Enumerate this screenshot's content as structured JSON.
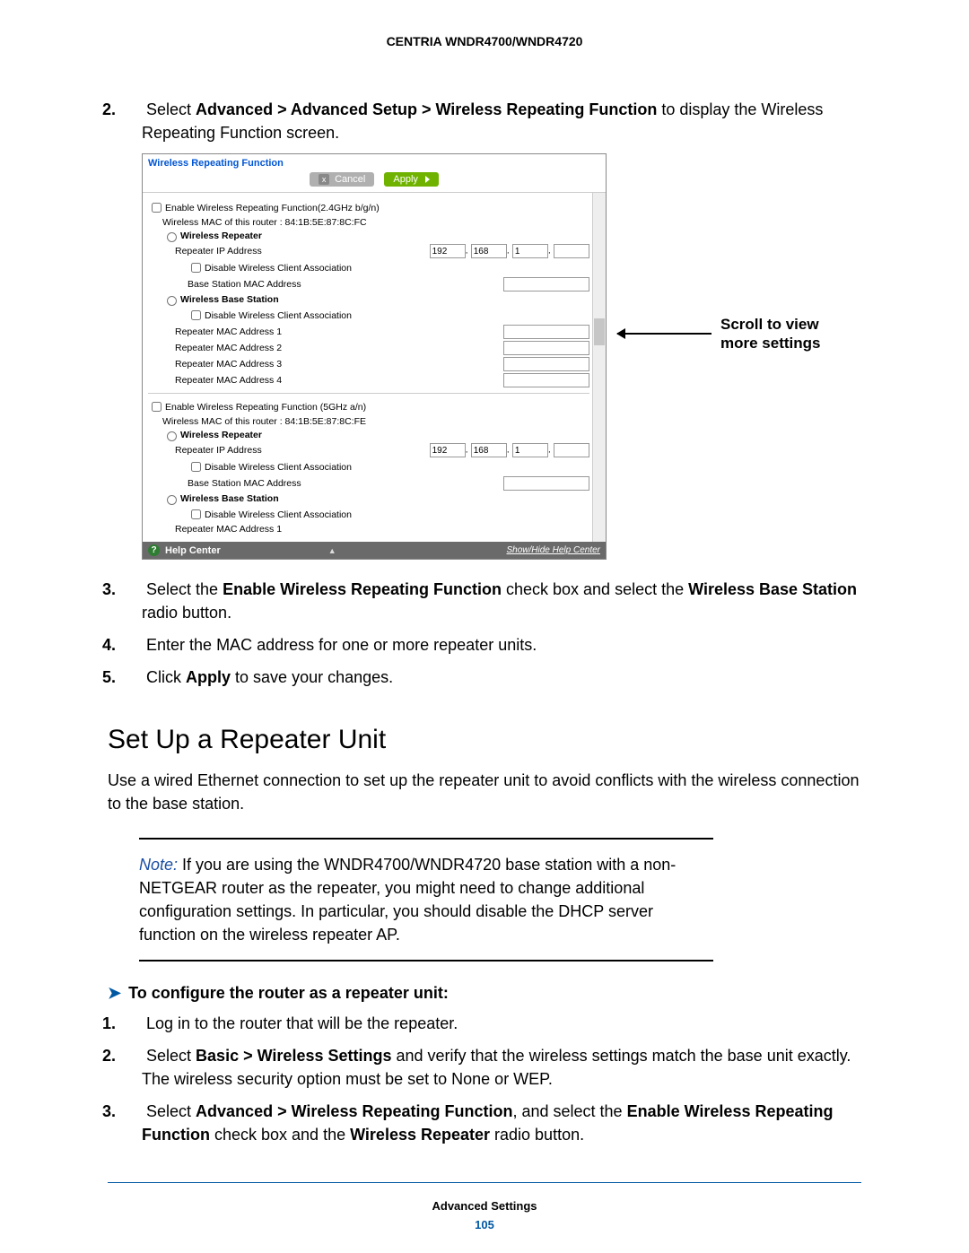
{
  "header": "CENTRIA WNDR4700/WNDR4720",
  "step2": {
    "num": "2.",
    "pre": "Select ",
    "path": "Advanced > Advanced Setup > Wireless Repeating Function",
    "post": " to display the Wireless Repeating Function screen."
  },
  "shot": {
    "title": "Wireless Repeating Function",
    "cancel": "Cancel",
    "apply": "Apply",
    "g24": {
      "enable": "Enable Wireless Repeating Function(2.4GHz b/g/n)",
      "mac": "Wireless MAC of this router : 84:1B:5E:87:8C:FC",
      "wr": "Wireless Repeater",
      "rip": "Repeater IP Address",
      "ip": [
        "192",
        "168",
        "1",
        ""
      ],
      "dwca": "Disable Wireless Client Association",
      "bsmac": "Base Station MAC Address",
      "wbs": "Wireless Base Station",
      "dwca2": "Disable Wireless Client Association",
      "r1": "Repeater MAC Address 1",
      "r2": "Repeater MAC Address 2",
      "r3": "Repeater MAC Address 3",
      "r4": "Repeater MAC Address 4"
    },
    "g5": {
      "enable": "Enable Wireless Repeating Function (5GHz a/n)",
      "mac": "Wireless MAC of this router : 84:1B:5E:87:8C:FE",
      "wr": "Wireless Repeater",
      "rip": "Repeater IP Address",
      "ip": [
        "192",
        "168",
        "1",
        ""
      ],
      "dwca": "Disable Wireless Client Association",
      "bsmac": "Base Station MAC Address",
      "wbs": "Wireless Base Station",
      "dwca2": "Disable Wireless Client Association",
      "r1": "Repeater MAC Address 1"
    },
    "help": "Help Center",
    "helplink": "Show/Hide Help Center"
  },
  "callout": {
    "l1": "Scroll to view",
    "l2": "more settings"
  },
  "step3": {
    "num": "3.",
    "pre": "Select the ",
    "b1": "Enable Wireless Repeating Function",
    "mid": " check box and select the ",
    "b2": "Wireless Base Station",
    "post": " radio button."
  },
  "step4": {
    "num": "4.",
    "text": "Enter the MAC address for one or more repeater units."
  },
  "step5": {
    "num": "5.",
    "pre": "Click ",
    "b": "Apply",
    "post": " to save your changes."
  },
  "h2": "Set Up a Repeater Unit",
  "para": "Use a wired Ethernet connection to set up the repeater unit to avoid conflicts with the wireless connection to the base station.",
  "note": {
    "label": "Note:  ",
    "text": "If you are using the WNDR4700/WNDR4720 base station with a non-NETGEAR router as the repeater, you might need to change additional configuration settings. In particular, you should disable the DHCP server function on the wireless repeater AP."
  },
  "task": "To configure the router as a repeater unit:",
  "t1": {
    "num": "1.",
    "text": "Log in to the router that will be the repeater."
  },
  "t2": {
    "num": "2.",
    "pre": "Select ",
    "b": "Basic > Wireless Settings",
    "post": " and verify that the wireless settings match the base unit exactly. The wireless security option must be set to None or WEP."
  },
  "t3": {
    "num": "3.",
    "pre": "Select ",
    "b1": "Advanced > Wireless Repeating Function",
    "mid": ", and select the ",
    "b2": "Enable Wireless Repeating Function",
    "mid2": " check box and the ",
    "b3": "Wireless Repeater",
    "post": " radio button."
  },
  "footer": {
    "section": "Advanced Settings",
    "page": "105"
  }
}
